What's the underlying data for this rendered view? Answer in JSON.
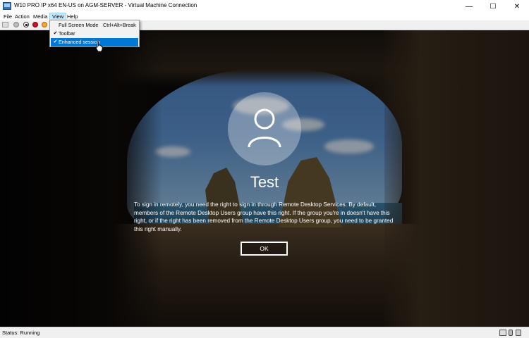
{
  "window": {
    "title": "W10 PRO IP x64 EN-US on AGM-SERVER - Virtual Machine Connection",
    "min_glyph": "—",
    "max_glyph": "☐",
    "close_glyph": "✕"
  },
  "menubar": {
    "items": [
      {
        "label": "File"
      },
      {
        "label": "Action"
      },
      {
        "label": "Media"
      },
      {
        "label": "View"
      },
      {
        "label": "Help"
      }
    ]
  },
  "toolbar": {
    "icons": [
      "ctrl-alt-del-icon",
      "start-icon",
      "turn-off-icon",
      "shutdown-icon",
      "save-icon"
    ]
  },
  "view_menu": {
    "items": [
      {
        "check": "",
        "label": "Full Screen Mode",
        "shortcut": "Ctrl+Alt+Break"
      },
      {
        "check": "✔",
        "label": "Toolbar",
        "shortcut": ""
      },
      {
        "check": "✔",
        "label": "Enhanced session",
        "shortcut": ""
      }
    ],
    "highlighted_index": 2
  },
  "login": {
    "username": "Test",
    "message": "To sign in remotely, you need the right to sign in through Remote Desktop Services. By default, members of the Remote Desktop Users group have this right. If the group you're in doesn't have this right, or if the right has been removed from the Remote Desktop Users group, you need to be granted this right manually.",
    "ok_label": "OK"
  },
  "statusbar": {
    "status": "Status: Running",
    "icons": [
      "keyboard-icon",
      "usb-icon",
      "lock-icon"
    ]
  },
  "colors": {
    "menu_highlight": "#0078d7",
    "shutdown_red": "#c8102e",
    "save_orange": "#f5a623"
  }
}
